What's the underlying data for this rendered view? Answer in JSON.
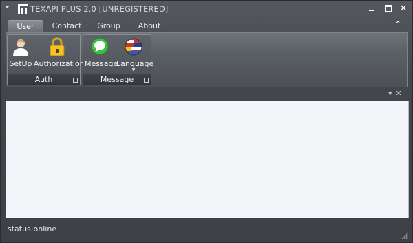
{
  "window": {
    "title": "TEXAPI PLUS 2.0 [UNREGISTERED]",
    "controls": {
      "minimize": "minimize",
      "maximize": "maximize",
      "close": "✕"
    }
  },
  "tabs": [
    {
      "label": "User",
      "active": true
    },
    {
      "label": "Contact",
      "active": false
    },
    {
      "label": "Group",
      "active": false
    },
    {
      "label": "About",
      "active": false
    }
  ],
  "ribbon": {
    "collapse_glyph": "⌃",
    "groups": [
      {
        "label": "Auth",
        "buttons": [
          {
            "label": "SetUp",
            "icon": "user-icon"
          },
          {
            "label": "Authorization",
            "icon": "padlock-icon"
          }
        ]
      },
      {
        "label": "Message",
        "buttons": [
          {
            "label": "Message",
            "icon": "speech-bubble-icon"
          },
          {
            "label": "Language",
            "icon": "flags-globe-icon",
            "dropdown": true
          }
        ]
      }
    ]
  },
  "panel_tools": {
    "pin": "▾",
    "close": "✕"
  },
  "status": {
    "text": "status:online"
  },
  "colors": {
    "accent": "#4a4d53",
    "content_bg": "#f3f5f9"
  }
}
